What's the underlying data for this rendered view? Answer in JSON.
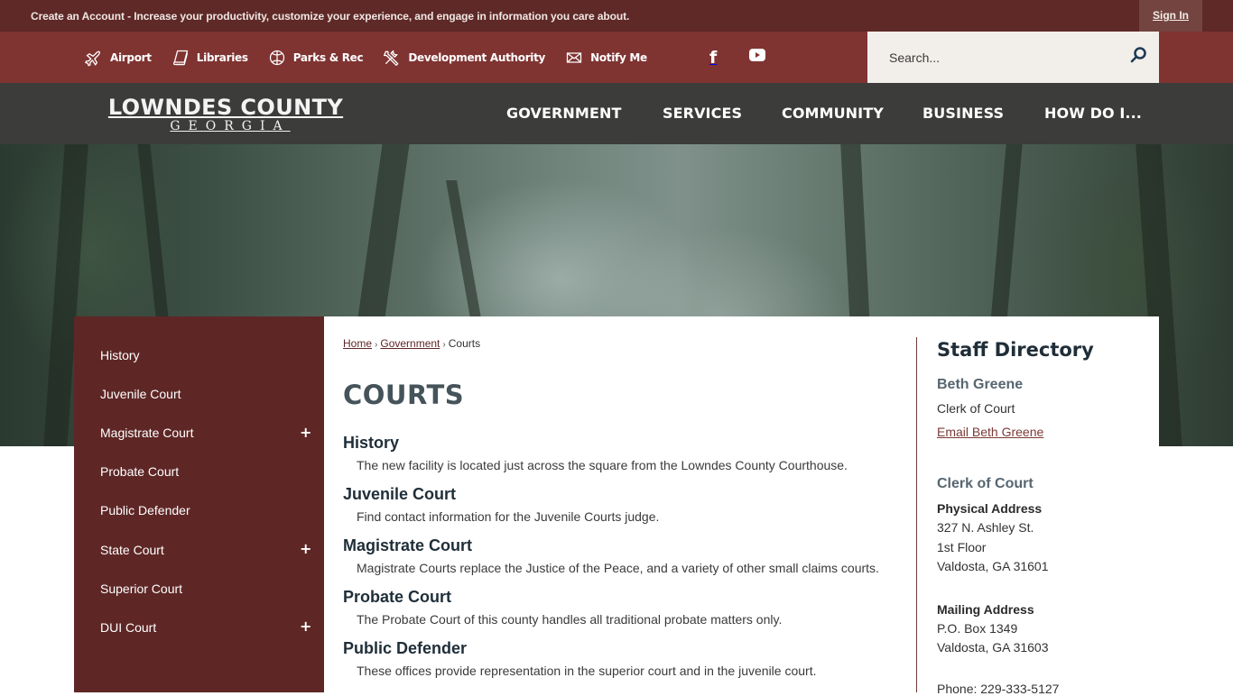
{
  "account_bar": {
    "create_account_link": "Create an Account",
    "promo_text": " - Increase your productivity, customize your experience, and engage in information you care about.",
    "sign_in_label": "Sign In"
  },
  "utility_bar": {
    "links": [
      {
        "label": "Airport",
        "icon": "airplane-icon"
      },
      {
        "label": "Libraries",
        "icon": "book-icon"
      },
      {
        "label": "Parks & Rec",
        "icon": "ball-icon"
      },
      {
        "label": "Development Authority",
        "icon": "tools-icon"
      },
      {
        "label": "Notify Me",
        "icon": "envelope-icon"
      }
    ],
    "social": [
      {
        "name": "facebook",
        "icon": "facebook-icon",
        "glyph": "f"
      },
      {
        "name": "youtube",
        "icon": "youtube-icon"
      }
    ],
    "search": {
      "placeholder": "Search...",
      "value": ""
    }
  },
  "logo": {
    "line1": "LOWNDES COUNTY",
    "line2": "GEORGIA"
  },
  "main_nav": {
    "items": [
      {
        "label": "GOVERNMENT"
      },
      {
        "label": "SERVICES"
      },
      {
        "label": "COMMUNITY"
      },
      {
        "label": "BUSINESS"
      },
      {
        "label": "HOW DO I..."
      }
    ]
  },
  "side_nav": {
    "items": [
      {
        "label": "History",
        "expandable": false
      },
      {
        "label": "Juvenile Court",
        "expandable": false
      },
      {
        "label": "Magistrate Court",
        "expandable": true
      },
      {
        "label": "Probate Court",
        "expandable": false
      },
      {
        "label": "Public Defender",
        "expandable": false
      },
      {
        "label": "State Court",
        "expandable": true
      },
      {
        "label": "Superior Court",
        "expandable": false
      },
      {
        "label": "DUI Court",
        "expandable": true
      }
    ],
    "expand_glyph": "+"
  },
  "breadcrumb": {
    "items": [
      {
        "label": "Home",
        "link": true
      },
      {
        "label": "Government",
        "link": true
      },
      {
        "label": "Courts",
        "link": false
      }
    ],
    "separator": "›"
  },
  "page": {
    "title": "COURTS",
    "entries": [
      {
        "title": "History",
        "description": "The new facility is located just across the square from the Lowndes County Courthouse."
      },
      {
        "title": "Juvenile Court",
        "description": "Find contact information for the Juvenile Courts judge."
      },
      {
        "title": "Magistrate Court",
        "description": "Magistrate Courts replace the Justice of the Peace, and a variety of other small claims courts."
      },
      {
        "title": "Probate Court",
        "description": "The Probate Court of this county handles all traditional probate matters only."
      },
      {
        "title": "Public Defender",
        "description": "These offices provide representation in the superior court and in the juvenile court."
      }
    ]
  },
  "staff_directory": {
    "title": "Staff Directory",
    "name": "Beth Greene",
    "role": "Clerk of Court",
    "email_link": "Email Beth Greene",
    "department": "Clerk of Court",
    "physical_address_label": "Physical Address",
    "physical_address": [
      "327 N. Ashley St.",
      "1st Floor",
      "Valdosta, GA 31601"
    ],
    "mailing_address_label": "Mailing Address",
    "mailing_address": [
      "P.O. Box 1349",
      "Valdosta, GA 31603"
    ],
    "phone": "Phone: 229-333-5127"
  },
  "colors": {
    "account_bar": "#5e2927",
    "utility_bar": "#7f3432",
    "main_nav": "#3c3c3b",
    "side_nav": "#5e2726",
    "heading": "#1f2e38",
    "title": "#45535a",
    "link": "#7b3a36"
  }
}
